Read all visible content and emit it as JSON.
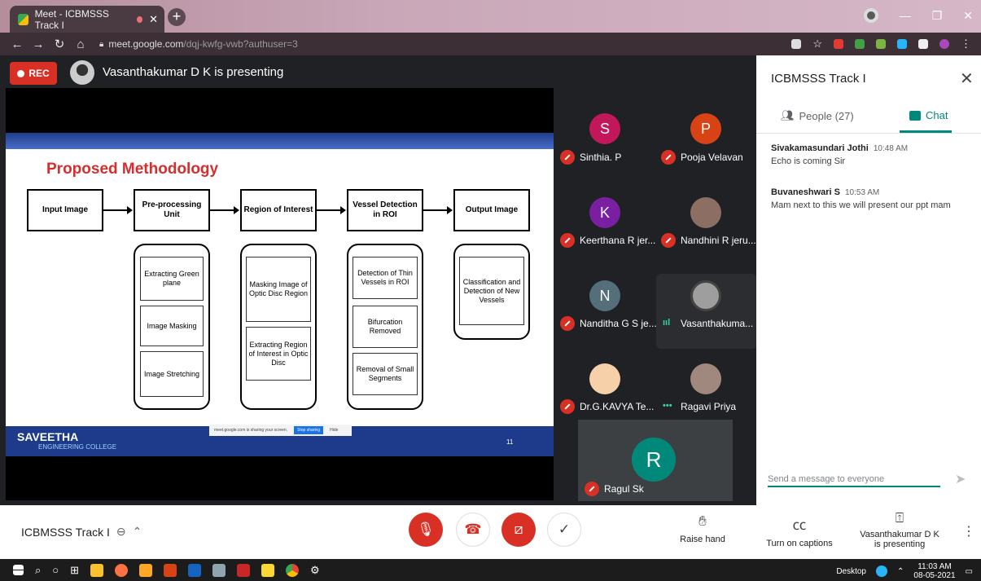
{
  "browser": {
    "tab_title": "Meet - ICBMSSS Track I",
    "url_host": "meet.google.com",
    "url_path": "/dqj-kwfg-vwb?authuser=3"
  },
  "stage": {
    "rec_label": "REC",
    "presenting_text": "Vasanthakumar D K is presenting"
  },
  "slide": {
    "title": "Proposed Methodology",
    "steps": [
      "Input Image",
      "Pre-processing Unit",
      "Region of Interest",
      "Vessel Detection in ROI",
      "Output Image"
    ],
    "preprocessing": [
      "Extracting Green plane",
      "Image Masking",
      "Image Stretching"
    ],
    "roi": [
      "Masking Image of Optic Disc Region",
      "Extracting Region of Interest in Optic Disc"
    ],
    "vessel": [
      "Detection of Thin Vessels in ROI",
      "Bifurcation Removed",
      "Removal of Small Segments"
    ],
    "output": [
      "Classification and Detection of New Vessels"
    ],
    "college": "SAVEETHA",
    "college_sub": "ENGINEERING COLLEGE",
    "share_notice": "meet.google.com is sharing your screen.",
    "stop_sharing": "Stop sharing",
    "hide": "Hide",
    "page_number": "11"
  },
  "participants": [
    {
      "initial": "S",
      "name": "Sinthia. P",
      "color": "#c2185b",
      "status": "muted"
    },
    {
      "initial": "P",
      "name": "Pooja Velavan",
      "color": "#d84315",
      "status": "muted"
    },
    {
      "initial": "K",
      "name": "Keerthana R jer...",
      "color": "#7b1fa2",
      "status": "muted"
    },
    {
      "initial": "",
      "name": "Nandhini R jeru...",
      "color": "#8d6e63",
      "status": "muted"
    },
    {
      "initial": "N",
      "name": "Nanditha G S je...",
      "color": "#546e7a",
      "status": "muted"
    },
    {
      "initial": "",
      "name": "Vasanthakuma...",
      "color": "#9e9e9e",
      "status": "speaking"
    },
    {
      "initial": "",
      "name": "Dr.G.KAVYA Te...",
      "color": "#f5d0a9",
      "status": "muted"
    },
    {
      "initial": "",
      "name": "Ragavi Priya",
      "color": "#a1887f",
      "status": "more"
    },
    {
      "initial": "R",
      "name": "Ragul Sk",
      "color": "#00897b",
      "status": "muted"
    }
  ],
  "panel": {
    "title": "ICBMSSS Track I",
    "people_tab": "People (27)",
    "chat_tab": "Chat",
    "messages": [
      {
        "sender": "Sivakamasundari Jothi",
        "time": "10:48 AM",
        "text": "Echo is coming Sir"
      },
      {
        "sender": "Buvaneshwari S",
        "time": "10:53 AM",
        "text": "Mam next to this we will present our ppt mam"
      }
    ],
    "input_placeholder": "Send a message to everyone"
  },
  "bottombar": {
    "meeting_name": "ICBMSSS Track I",
    "raise_hand": "Raise hand",
    "captions": "Turn on captions",
    "presenting_line1": "Vasanthakumar D K",
    "presenting_line2": "is presenting"
  },
  "taskbar": {
    "desktop": "Desktop",
    "time": "11:03 AM",
    "date": "08-05-2021"
  }
}
